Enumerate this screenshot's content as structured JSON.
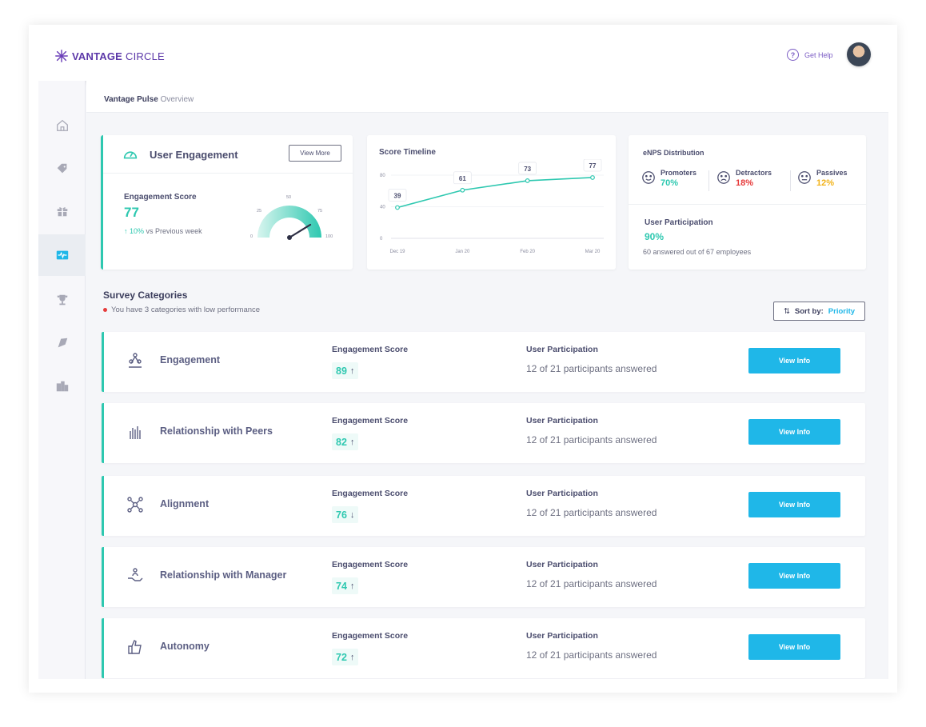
{
  "brand": {
    "logo_bold": "VANTAGE",
    "logo_light": "CIRCLE"
  },
  "header": {
    "help_label": "Get Help",
    "help_icon": "question-circle-icon"
  },
  "breadcrumb": {
    "main": "Vantage Pulse",
    "sub": "Overview"
  },
  "sidebar": {
    "items": [
      {
        "icon": "home-icon"
      },
      {
        "icon": "tag-icon"
      },
      {
        "icon": "gift-icon"
      },
      {
        "icon": "pulse-icon",
        "active": true
      },
      {
        "icon": "trophy-icon"
      },
      {
        "icon": "compass-icon"
      },
      {
        "icon": "buildings-icon"
      }
    ]
  },
  "user_engagement": {
    "title": "User Engagement",
    "view_more": "View More",
    "score_label": "Engagement Score",
    "score": "77",
    "trend_pct": "10%",
    "trend_text": "vs Previous week",
    "gauge_ticks": [
      "0",
      "25",
      "50",
      "75",
      "100"
    ]
  },
  "timeline": {
    "title": "Score Timeline",
    "y_ticks": [
      "0",
      "40",
      "80"
    ],
    "x_labels": [
      "Dec 19",
      "Jan 20",
      "Feb 20",
      "Mar 20"
    ]
  },
  "chart_data": {
    "type": "line",
    "title": "Score Timeline",
    "xlabel": "",
    "ylabel": "",
    "ylim": [
      0,
      80
    ],
    "x": [
      "Dec 19",
      "Jan 20",
      "Feb 20",
      "Mar 20"
    ],
    "series": [
      {
        "values": [
          39,
          61,
          73,
          77
        ],
        "color": "#2ec8b0"
      }
    ],
    "point_labels": [
      "39",
      "61",
      "73",
      "77"
    ],
    "grid": true
  },
  "enps": {
    "title": "eNPS Distribution",
    "promoters": {
      "label": "Promoters",
      "value": "70%",
      "color": "#2ec8b0"
    },
    "detractors": {
      "label": "Detractors",
      "value": "18%",
      "color": "#e63b3b"
    },
    "passives": {
      "label": "Passives",
      "value": "12%",
      "color": "#f2b31a"
    }
  },
  "participation": {
    "title": "User Participation",
    "value": "90%",
    "sub": "60 answered out of 67 employees"
  },
  "survey": {
    "title": "Survey Categories",
    "warning": "You have 3 categories with low performance",
    "sort_label": "Sort by:",
    "sort_value": "Priority",
    "es_label": "Engagement Score",
    "up_label": "User Participation",
    "button_label": "View Info",
    "rows": [
      {
        "name": "Engagement",
        "icon": "triangle-people-icon",
        "score": "89",
        "trend": "↑",
        "participation": "12 of 21 participants answered"
      },
      {
        "name": "Relationship with Peers",
        "icon": "high-five-icon",
        "score": "82",
        "trend": "↑",
        "participation": "12 of 21 participants answered"
      },
      {
        "name": "Alignment",
        "icon": "network-icon",
        "score": "76",
        "trend": "↓",
        "participation": "12 of 21 participants answered"
      },
      {
        "name": "Relationship with Manager",
        "icon": "hand-person-icon",
        "score": "74",
        "trend": "↑",
        "participation": "12 of 21 participants answered"
      },
      {
        "name": "Autonomy",
        "icon": "thumbs-up-icon",
        "score": "72",
        "trend": "↑",
        "participation": "12 of 21 participants answered"
      }
    ]
  }
}
